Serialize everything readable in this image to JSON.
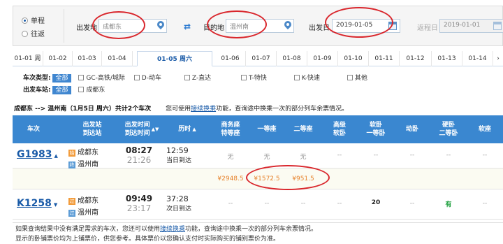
{
  "search": {
    "trip_types": [
      "单程",
      "往返"
    ],
    "from_label": "出发地",
    "from_value": "成都东",
    "to_label": "目的地",
    "to_value": "温州南",
    "date_label": "出发日",
    "date_value": "2019-01-05",
    "return_label": "返程日",
    "return_value": "2019-01-01"
  },
  "date_tabs": [
    "01-01 周",
    "01-02",
    "01-03",
    "01-04",
    "01-05 周六",
    "01-06",
    "01-07",
    "01-08",
    "01-09",
    "01-10",
    "01-11",
    "01-12",
    "01-13",
    "01-14"
  ],
  "filters": {
    "type_label": "车次类型:",
    "all": "全部",
    "types": [
      "GC-高铁/城际",
      "D-动车",
      "Z-直达",
      "T-特快",
      "K-快速",
      "其他"
    ],
    "station_label": "出发车站:",
    "stations": [
      "成都东"
    ]
  },
  "summary": {
    "route": "成都东 --> 温州南（1月5日 周六）共计2个车次",
    "hint_pre": "您可使用",
    "hint_link": "接续换乘",
    "hint_post": "功能，查询途中换乘一次的部分列车余票情况。"
  },
  "columns": [
    "车次",
    "出发站\n到达站",
    "出发时间\n到达时间",
    "历时",
    "商务座\n特等座",
    "一等座",
    "二等座",
    "高级\n软卧",
    "软卧\n一等卧",
    "动卧",
    "硬卧\n二等卧",
    "软座"
  ],
  "trains": [
    {
      "no": "G1983",
      "from": "成都东",
      "to": "温州南",
      "dep": "08:27",
      "arr": "21:26",
      "duration": "12:59",
      "arrival_day": "当日到达",
      "business": "无",
      "first": "无",
      "second": "无",
      "adv_soft": "--",
      "soft": "--",
      "dong": "--",
      "hard": "--",
      "soft_seat": "--",
      "price_business": "¥2948.5",
      "price_first": "¥1572.5",
      "price_second": "¥951.5"
    },
    {
      "no": "K1258",
      "from": "成都东",
      "to": "温州南",
      "dep": "09:49",
      "arr": "23:17",
      "duration": "37:28",
      "arrival_day": "次日到达",
      "business": "--",
      "first": "--",
      "second": "--",
      "adv_soft": "--",
      "soft": "20",
      "dong": "--",
      "hard": "有",
      "soft_seat": "--"
    }
  ],
  "note": {
    "line1_pre": "如果查询结果中没有满足需求的车次，您还可以使用",
    "line1_link": "接续换乘",
    "line1_post": "功能，查询途中换乘一次的部分列车余票情况。",
    "line2": "显示的卧铺票价均为上铺票价，供您参考。具体票价以您确认支付时实际购买的铺别票价为准。"
  }
}
